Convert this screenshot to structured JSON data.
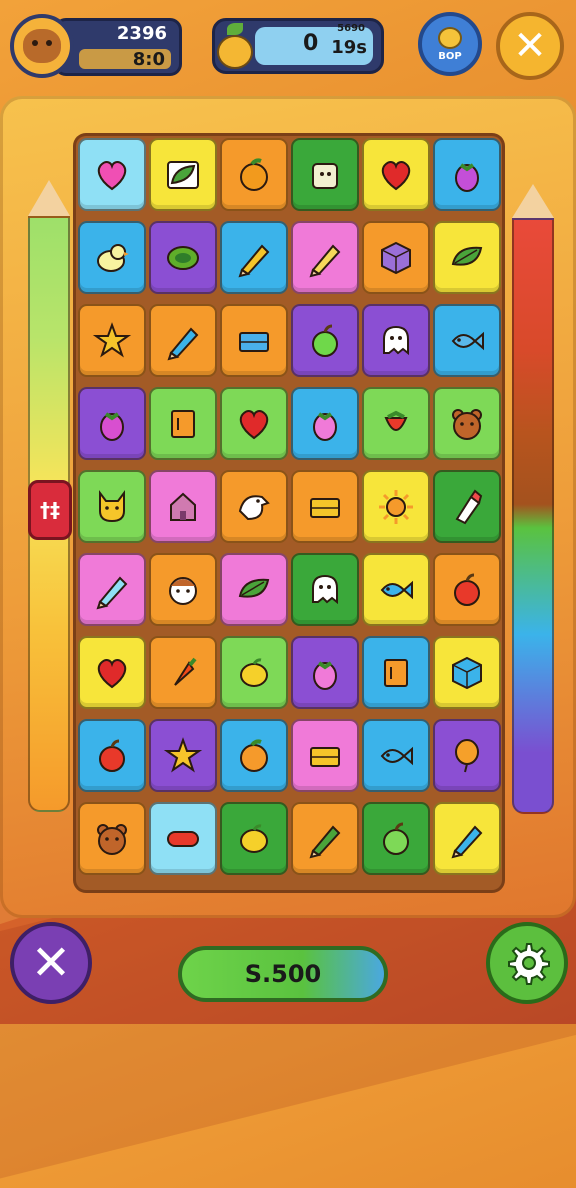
{
  "hud": {
    "avatar_icon": "bear-avatar-icon",
    "stat_top": "2396",
    "stat_bottom": "8:0",
    "lives_icon": "banana-icon",
    "lives_value": "0",
    "lives_small_top": "5690",
    "lives_small": "19s",
    "shop_label": "BOP",
    "close_icon": "close-icon"
  },
  "side_badge": "†‡",
  "bottom": {
    "left_icon": "cross-icon",
    "score": "S.500",
    "settings_icon": "gear-icon"
  },
  "colors": {
    "green": "#7ed957",
    "yellow": "#f7e53a",
    "orange": "#f59a2b",
    "red": "#e94a3a",
    "pink": "#f07ad8",
    "purple": "#8b4fd3",
    "blue": "#3bb3ea",
    "lightblue": "#8fe0f5",
    "darkgreen": "#3aa83a"
  },
  "board": {
    "rows": [
      [
        {
          "bg": "lightblue",
          "icon": "heart",
          "c": "#f04fb4"
        },
        {
          "bg": "yellow",
          "icon": "leaf-box",
          "c": "#4aa43a"
        },
        {
          "bg": "orange",
          "icon": "orange-fruit",
          "c": "#f29a1d"
        },
        {
          "bg": "darkgreen",
          "icon": "cup",
          "c": "#f2f0d0"
        },
        {
          "bg": "yellow",
          "icon": "heart",
          "c": "#e02a2a"
        },
        {
          "bg": "blue",
          "icon": "eggplant",
          "c": "#c44fd8"
        }
      ],
      [
        {
          "bg": "blue",
          "icon": "duck",
          "c": "#f8f3a0"
        },
        {
          "bg": "purple",
          "icon": "ring",
          "c": "#5fae2a"
        },
        {
          "bg": "blue",
          "icon": "crayon",
          "c": "#f5c52a"
        },
        {
          "bg": "pink",
          "icon": "crayon",
          "c": "#f5d85a"
        },
        {
          "bg": "orange",
          "icon": "cube",
          "c": "#9a6fd8"
        },
        {
          "bg": "yellow",
          "icon": "leaf",
          "c": "#4aa43a"
        }
      ],
      [
        {
          "bg": "orange",
          "icon": "star",
          "c": "#f5c52a"
        },
        {
          "bg": "orange",
          "icon": "crayon",
          "c": "#3bb3ea"
        },
        {
          "bg": "orange",
          "icon": "block",
          "c": "#4ab0ea"
        },
        {
          "bg": "purple",
          "icon": "apple",
          "c": "#6fd84a"
        },
        {
          "bg": "purple",
          "icon": "ghost",
          "c": "#ffffff"
        },
        {
          "bg": "blue",
          "icon": "fish",
          "c": "#5ab8ea"
        }
      ],
      [
        {
          "bg": "purple",
          "icon": "eggplant",
          "c": "#d84fd0"
        },
        {
          "bg": "green",
          "icon": "box",
          "c": "#f59a2b"
        },
        {
          "bg": "green",
          "icon": "heart",
          "c": "#e02a2a"
        },
        {
          "bg": "blue",
          "icon": "eggplant",
          "c": "#f07ad8"
        },
        {
          "bg": "green",
          "icon": "strawberry",
          "c": "#e8392a"
        },
        {
          "bg": "green",
          "icon": "bear",
          "c": "#c0652a"
        }
      ],
      [
        {
          "bg": "green",
          "icon": "dog",
          "c": "#f5c52a"
        },
        {
          "bg": "pink",
          "icon": "house",
          "c": "#d07ab0"
        },
        {
          "bg": "orange",
          "icon": "bird",
          "c": "#ffffff"
        },
        {
          "bg": "orange",
          "icon": "block",
          "c": "#f5c52a"
        },
        {
          "bg": "yellow",
          "icon": "sun",
          "c": "#f59a2b"
        },
        {
          "bg": "darkgreen",
          "icon": "bottle",
          "c": "#f04a4a"
        }
      ],
      [
        {
          "bg": "pink",
          "icon": "crayon",
          "c": "#8fe0f5"
        },
        {
          "bg": "orange",
          "icon": "face",
          "c": "#ffffff"
        },
        {
          "bg": "pink",
          "icon": "leaf",
          "c": "#4aa43a"
        },
        {
          "bg": "darkgreen",
          "icon": "ghost",
          "c": "#ffffff"
        },
        {
          "bg": "yellow",
          "icon": "fish",
          "c": "#3bb3ea"
        },
        {
          "bg": "orange",
          "icon": "apple",
          "c": "#e8392a"
        }
      ],
      [
        {
          "bg": "yellow",
          "icon": "heart",
          "c": "#e02a2a"
        },
        {
          "bg": "orange",
          "icon": "carrot",
          "c": "#f24a1a"
        },
        {
          "bg": "green",
          "icon": "lemon",
          "c": "#f5d02a"
        },
        {
          "bg": "purple",
          "icon": "eggplant",
          "c": "#f07ad8"
        },
        {
          "bg": "blue",
          "icon": "box",
          "c": "#f59a2b"
        },
        {
          "bg": "yellow",
          "icon": "cube",
          "c": "#3bb3ea"
        }
      ],
      [
        {
          "bg": "blue",
          "icon": "apple",
          "c": "#e8392a"
        },
        {
          "bg": "purple",
          "icon": "star",
          "c": "#f5c52a"
        },
        {
          "bg": "blue",
          "icon": "orange-fruit",
          "c": "#f59a2b"
        },
        {
          "bg": "pink",
          "icon": "block",
          "c": "#f5c52a"
        },
        {
          "bg": "blue",
          "icon": "fish",
          "c": "#3bb3ea"
        },
        {
          "bg": "purple",
          "icon": "balloon",
          "c": "#f5a02a"
        }
      ],
      [
        {
          "bg": "orange",
          "icon": "bear",
          "c": "#c0652a"
        },
        {
          "bg": "lightblue",
          "icon": "sausage",
          "c": "#e8392a"
        },
        {
          "bg": "darkgreen",
          "icon": "lemon",
          "c": "#f5d02a"
        },
        {
          "bg": "orange",
          "icon": "crayon",
          "c": "#4aa43a"
        },
        {
          "bg": "darkgreen",
          "icon": "apple",
          "c": "#7ed957"
        },
        {
          "bg": "yellow",
          "icon": "crayon",
          "c": "#3bb3ea"
        }
      ]
    ]
  },
  "pencils": {
    "left": {
      "color": "#7ed957"
    },
    "right": {
      "color": "#e94a3a"
    }
  }
}
